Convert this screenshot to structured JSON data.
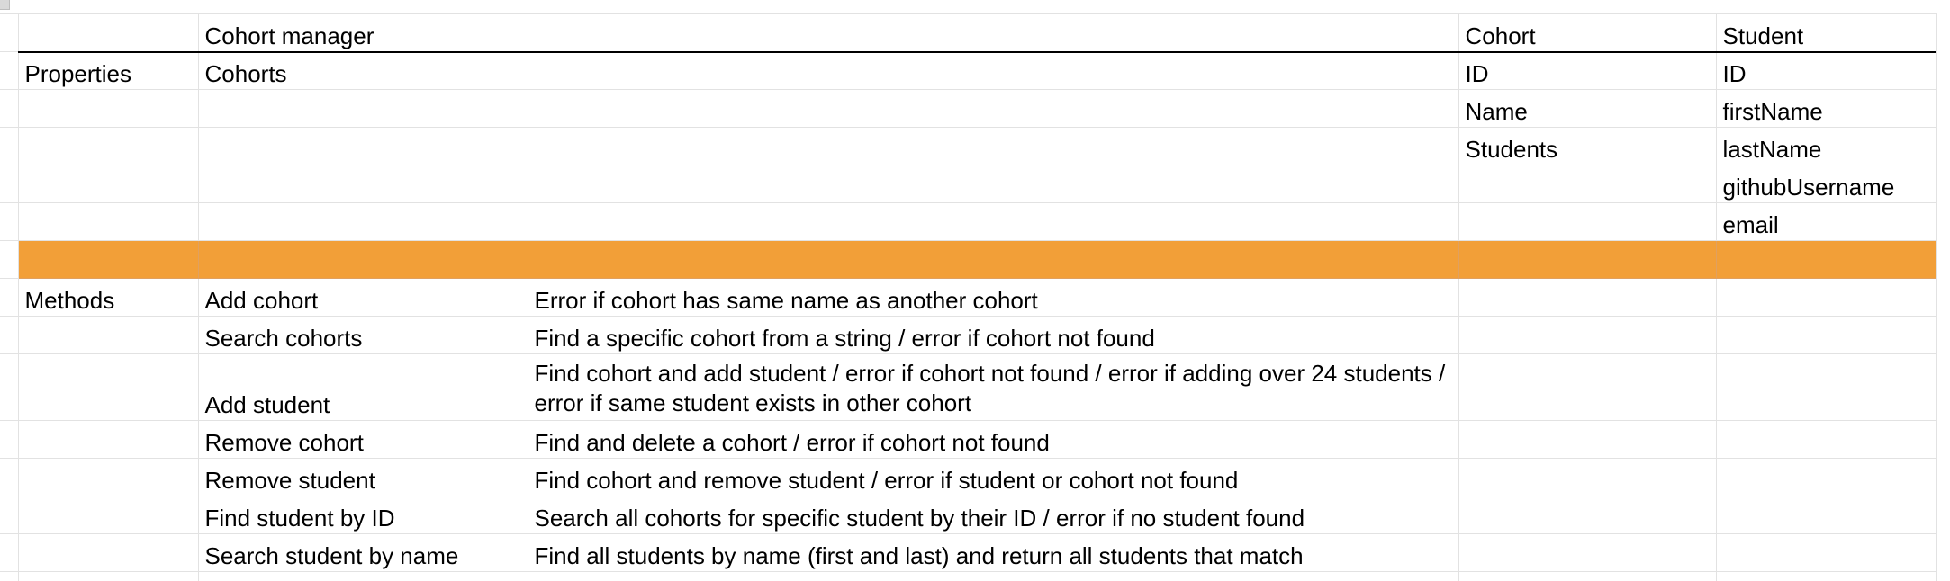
{
  "sheet": {
    "header": {
      "col_b": "Cohort manager",
      "col_d": "Cohort",
      "col_e": "Student"
    },
    "properties": {
      "label": "Properties",
      "b_value": "Cohorts",
      "cohort_props": [
        "ID",
        "Name",
        "Students"
      ],
      "student_props": [
        "ID",
        "firstName",
        "lastName",
        "githubUsername",
        "email"
      ]
    },
    "methods": {
      "label": "Methods",
      "rows": [
        {
          "name": "Add cohort",
          "description": "Error if cohort has same name as another cohort"
        },
        {
          "name": "Search cohorts",
          "description": "Find a specific cohort from a string / error if cohort not found"
        },
        {
          "name": "Add student",
          "description": "Find cohort and add student / error if cohort not found / error if adding over 24 students / error if same student exists in other cohort"
        },
        {
          "name": "Remove cohort",
          "description": "Find and delete a cohort / error if cohort not found"
        },
        {
          "name": "Remove student",
          "description": "Find cohort and remove student / error if student or cohort not found"
        },
        {
          "name": "Find student by ID",
          "description": "Search all cohorts for specific student by their ID / error if no student found"
        },
        {
          "name": "Search student by name",
          "description": "Find all students by name (first and last) and return all students that match"
        }
      ]
    },
    "highlight_color": "#f29f38"
  }
}
